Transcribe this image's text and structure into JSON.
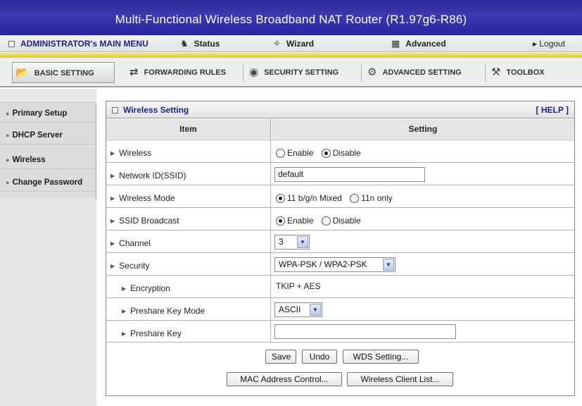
{
  "header": {
    "title": "Multi-Functional Wireless Broadband NAT Router (R1.97g6-R86)"
  },
  "main_menu": {
    "admin": "ADMINISTRATOR's MAIN MENU",
    "status": "Status",
    "wizard": "Wizard",
    "advanced": "Advanced",
    "logout": "▸ Logout"
  },
  "tabs": [
    {
      "label": "BASIC SETTING",
      "icon": "folder-icon",
      "active": true
    },
    {
      "label": "FORWARDING RULES",
      "icon": "arrows-icon"
    },
    {
      "label": "SECURITY SETTING",
      "icon": "shield-icon"
    },
    {
      "label": "ADVANCED SETTING",
      "icon": "gears-icon"
    },
    {
      "label": "TOOLBOX",
      "icon": "toolbox-icon"
    }
  ],
  "sidebar": {
    "items": [
      {
        "label": "Primary Setup"
      },
      {
        "label": "DHCP Server"
      },
      {
        "label": "Wireless"
      },
      {
        "label": "Change Password"
      }
    ]
  },
  "panel": {
    "title": "Wireless Setting",
    "help": "[ HELP ]",
    "col_item": "Item",
    "col_setting": "Setting"
  },
  "rows": {
    "wireless": {
      "label": "Wireless",
      "enable": "Enable",
      "disable": "Disable",
      "selected": "Disable"
    },
    "ssid": {
      "label": "Network ID(SSID)",
      "value": "default"
    },
    "mode": {
      "label": "Wireless Mode",
      "opt1": "11 b/g/n Mixed",
      "opt2": "11n only",
      "selected": "11 b/g/n Mixed"
    },
    "broadcast": {
      "label": "SSID Broadcast",
      "enable": "Enable",
      "disable": "Disable",
      "selected": "Enable"
    },
    "channel": {
      "label": "Channel",
      "value": "3"
    },
    "security": {
      "label": "Security",
      "value": "WPA-PSK / WPA2-PSK"
    },
    "encryption": {
      "label": "Encryption",
      "value": "TKIP + AES"
    },
    "key_mode": {
      "label": "Preshare Key Mode",
      "value": "ASCII"
    },
    "key": {
      "label": "Preshare Key",
      "value": ""
    }
  },
  "buttons": {
    "save": "Save",
    "undo": "Undo",
    "wds": "WDS Setting...",
    "mac": "MAC Address Control...",
    "client_list": "Wireless Client List..."
  }
}
